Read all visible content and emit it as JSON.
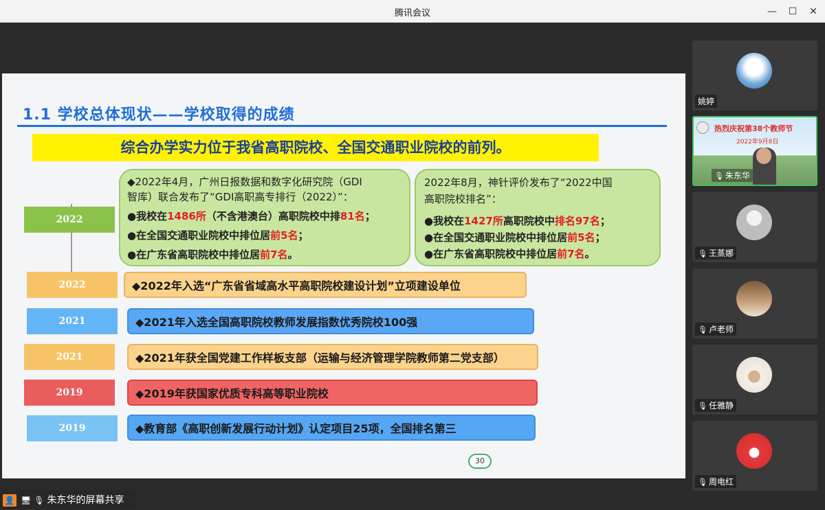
{
  "window": {
    "title": "腾讯会议",
    "min": "—",
    "max": "☐",
    "close": "✕"
  },
  "slide": {
    "heading": "1.1 学校总体现状——学校取得的成绩",
    "banner": "综合办学实力位于我省高职院校、全国交通职业院校的前列。",
    "bubble1": {
      "l1": "◆2022年4月，广州日报数据和数字化研究院（GDI",
      "l2": "智库）联合发布了“GDI高职高专排行（2022）”：",
      "l3a": "●我校在",
      "l3r": "1486所",
      "l3b": "（不含港澳台）高职院校中排",
      "l3r2": "81名",
      "l3c": "；",
      "l4a": "●在全国交通职业院校中排位居",
      "l4r": "前5名",
      "l4c": "；",
      "l5a": "●在广东省高职院校中排位居",
      "l5r": "前7名",
      "l5c": "。"
    },
    "bubble2": {
      "l1": "2022年8月，神针评价发布了“2022中国",
      "l2": "高职院校排名”：",
      "l3a": "●我校在",
      "l3r": "1427所",
      "l3b": "高职院校中",
      "l3r2": "排名97名",
      "l3c": "；",
      "l4a": "●在全国交通职业院校中排位居",
      "l4r": "前5名",
      "l4c": "；",
      "l5a": "●在广东省高职院校中排位居",
      "l5r": "前7名",
      "l5c": "。"
    },
    "tags": [
      "2022",
      "2022",
      "2021",
      "2021",
      "2019",
      "2019"
    ],
    "rows": [
      "◆2022年入选“广东省省域高水平高职院校建设计划”立项建设单位",
      "◆2021年入选全国高职院校教师发展指数优秀院校100强",
      "◆2021年获全国党建工作样板支部（运输与经济管理学院教师第二党支部）",
      "◆2019年获国家优质专科高等职业院校",
      "◆教育部《高职创新发展行动计划》认定项目25项，全国排名第三"
    ],
    "page": "30"
  },
  "participants": [
    {
      "name": "姚婷"
    },
    {
      "name": "朱东华",
      "banner": "热烈庆祝第38个教师节",
      "date": "2022年9月8日"
    },
    {
      "name": "王蒸娜"
    },
    {
      "name": "卢老师"
    },
    {
      "name": "任雅静"
    },
    {
      "name": "周电红"
    }
  ],
  "share": {
    "label": "朱东华的屏幕共享"
  },
  "colors": {
    "accent": "#1f6fd8",
    "banner": "#fff200",
    "active": "#43c05c"
  }
}
